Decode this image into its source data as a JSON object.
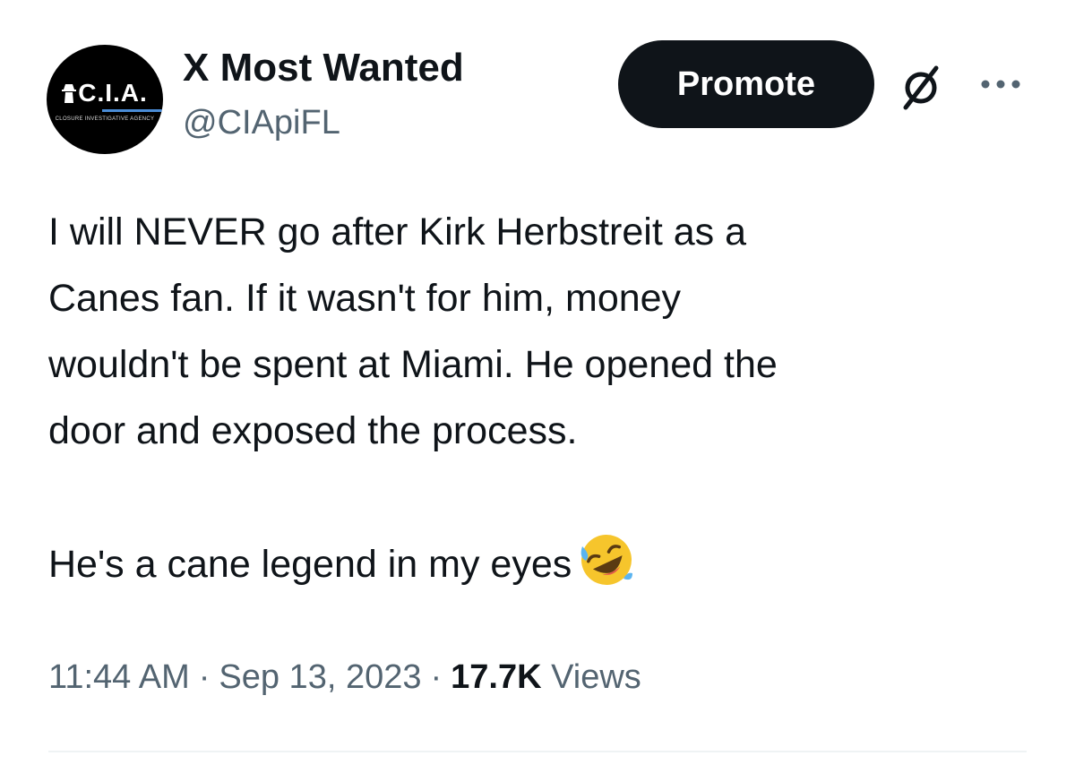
{
  "author": {
    "display_name": "X Most Wanted",
    "handle": "@CIApiFL",
    "avatar": {
      "logo_text": "C.I.A.",
      "subtitle": "CLOSURE INVESTIGATIVE AGENCY",
      "background": "#000000",
      "accent": "#4a8cd6"
    }
  },
  "header_actions": {
    "promote_label": "Promote",
    "grok_icon": "grok-slash-icon",
    "more_icon": "more-horizontal-icon"
  },
  "tweet": {
    "paragraph_1": "I will NEVER go after Kirk Herbstreit as a\nCanes fan. If it wasn't for him, money\nwouldn't be spent at Miami. He opened the\ndoor and exposed the process.",
    "paragraph_2": "He's a cane legend in my eyes",
    "emoji": "rolling-on-the-floor-laughing-emoji"
  },
  "meta": {
    "time": "11:44 AM",
    "separator": "·",
    "date": "Sep 13, 2023",
    "views_count": "17.7K",
    "views_label": "Views"
  },
  "colors": {
    "text_primary": "#0f1419",
    "text_secondary": "#536471",
    "button_bg": "#0f1419",
    "divider": "#eff3f4"
  }
}
